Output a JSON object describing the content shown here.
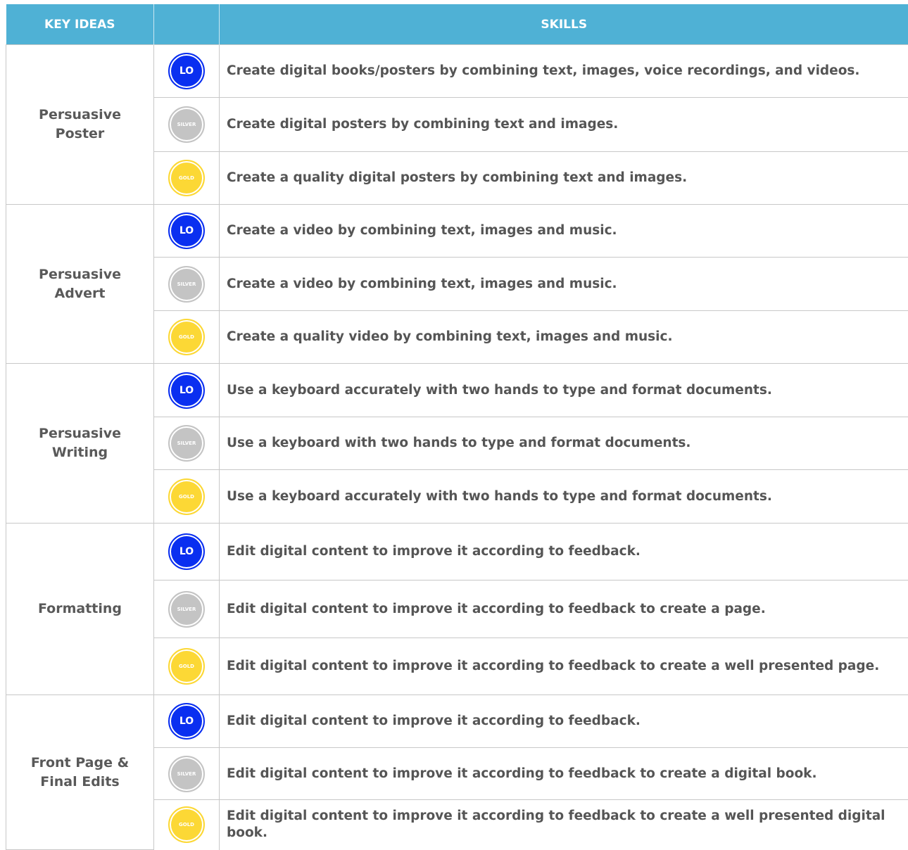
{
  "headers": {
    "key_ideas": "KEY IDEAS",
    "skills": "SKILLS"
  },
  "badges": {
    "lo": "LO",
    "silver": "SILVER",
    "gold": "GOLD"
  },
  "colors": {
    "header": "#4fb1d5",
    "lo": "#0a2ff0",
    "silver": "#c4c4c4",
    "gold": "#fcd835",
    "text": "#555555"
  },
  "groups": [
    {
      "key": "Persuasive Poster",
      "rows": [
        {
          "level": "lo",
          "skill": "Create digital books/posters by combining text, images, voice recordings, and videos."
        },
        {
          "level": "silver",
          "skill": "Create digital posters by combining text and images."
        },
        {
          "level": "gold",
          "skill": "Create a quality digital posters by combining text and images."
        }
      ]
    },
    {
      "key": "Persuasive Advert",
      "rows": [
        {
          "level": "lo",
          "skill": "Create a video by combining text, images and music."
        },
        {
          "level": "silver",
          "skill": "Create a video by combining text, images and music."
        },
        {
          "level": "gold",
          "skill": "Create a quality video by combining text, images and music."
        }
      ]
    },
    {
      "key": "Persuasive Writing",
      "rows": [
        {
          "level": "lo",
          "skill": "Use a keyboard accurately with two hands to type and format documents."
        },
        {
          "level": "silver",
          "skill": "Use a keyboard with two hands to type and format documents."
        },
        {
          "level": "gold",
          "skill": "Use a keyboard accurately with two hands to type and format documents."
        }
      ]
    },
    {
      "key": "Formatting",
      "rows": [
        {
          "level": "lo",
          "skill": "Edit digital content to improve it according to feedback."
        },
        {
          "level": "silver",
          "skill": "Edit digital content to improve it according to feedback to create a page."
        },
        {
          "level": "gold",
          "skill": "Edit digital content to improve it according to feedback to create a well presented page."
        }
      ]
    },
    {
      "key": "Front Page & Final Edits",
      "rows": [
        {
          "level": "lo",
          "skill": "Edit digital content to improve it according to feedback."
        },
        {
          "level": "silver",
          "skill": "Edit digital content to improve it according to feedback to create a digital book."
        },
        {
          "level": "gold",
          "skill": "Edit digital content to improve it according to feedback to create a well presented digital book."
        }
      ]
    }
  ]
}
